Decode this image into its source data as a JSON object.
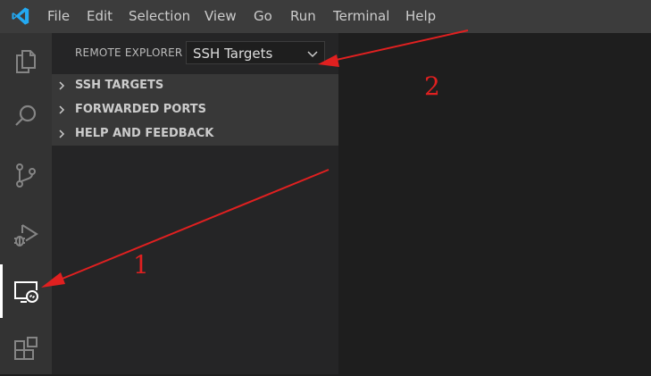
{
  "menubar": {
    "items": [
      "File",
      "Edit",
      "Selection",
      "View",
      "Go",
      "Run",
      "Terminal",
      "Help"
    ]
  },
  "activitybar": {
    "icons": [
      "explorer-icon",
      "search-icon",
      "source-control-icon",
      "run-debug-icon",
      "remote-explorer-icon",
      "extensions-icon"
    ],
    "active": "remote-explorer-icon"
  },
  "sidebar": {
    "title": "REMOTE EXPLORER",
    "select_value": "SSH Targets",
    "sections": [
      "SSH TARGETS",
      "FORWARDED PORTS",
      "HELP AND FEEDBACK"
    ]
  },
  "annotations": {
    "label_1": "1",
    "label_2": "2"
  },
  "colors": {
    "menubar": "#3c3c3c",
    "activitybar": "#333333",
    "sidebar": "#252526",
    "editor": "#1e1e1e",
    "annotation": "#e02020",
    "vscode_blue": "#23a9f2"
  }
}
